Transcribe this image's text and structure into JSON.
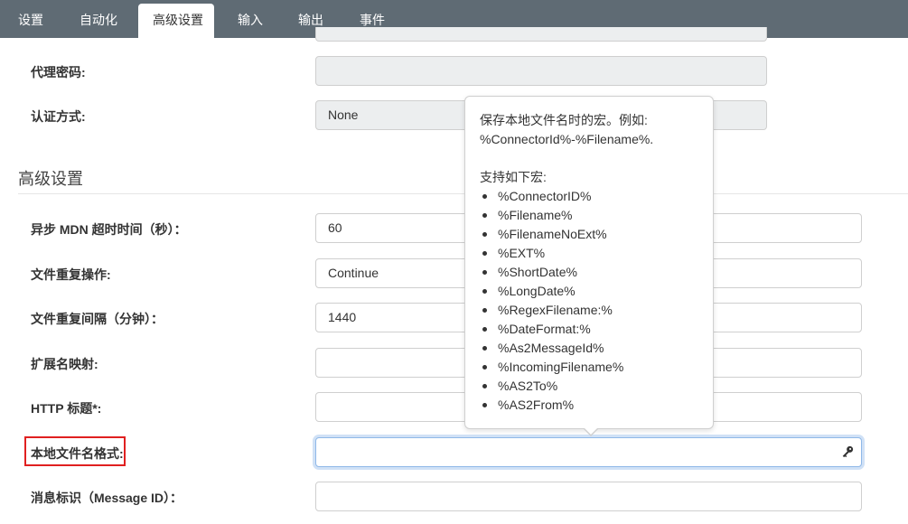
{
  "tabs": [
    {
      "label": "设置",
      "active": false
    },
    {
      "label": "自动化",
      "active": false
    },
    {
      "label": "高级设置",
      "active": true
    },
    {
      "label": "输入",
      "active": false
    },
    {
      "label": "输出",
      "active": false
    },
    {
      "label": "事件",
      "active": false
    }
  ],
  "proxy_password": {
    "label": "代理密码:",
    "value": ""
  },
  "auth_method": {
    "label": "认证方式:",
    "value": "None"
  },
  "section_title": "高级设置",
  "fields": {
    "async_mdn_timeout": {
      "label": "异步 MDN 超时时间（秒）：",
      "value": "60"
    },
    "file_duplicate_action": {
      "label": "文件重复操作:",
      "value": "Continue"
    },
    "file_duplicate_interval": {
      "label": "文件重复间隔（分钟）：",
      "value": "1440"
    },
    "extension_map": {
      "label": "扩展名映射:",
      "value": ""
    },
    "http_headers": {
      "label": "HTTP 标题*:",
      "value": ""
    },
    "local_file_name_format": {
      "label": "本地文件名格式:",
      "value": ""
    },
    "message_id": {
      "label": "消息标识（Message ID）：",
      "value": ""
    }
  },
  "tooltip": {
    "line1": "保存本地文件名时的宏。例如:",
    "line2": "%ConnectorId%-%Filename%.",
    "list_heading": "支持如下宏:",
    "macros": [
      "%ConnectorID%",
      "%Filename%",
      "%FilenameNoExt%",
      "%EXT%",
      "%ShortDate%",
      "%LongDate%",
      "%RegexFilename:%",
      "%DateFormat:%",
      "%As2MessageId%",
      "%IncomingFilename%",
      "%AS2To%",
      "%AS2From%"
    ]
  },
  "icons": {
    "key": "key-icon"
  },
  "colors": {
    "tabbar": "#5f6b74",
    "highlight": "#e02020",
    "focus": "#8fb8e8"
  }
}
